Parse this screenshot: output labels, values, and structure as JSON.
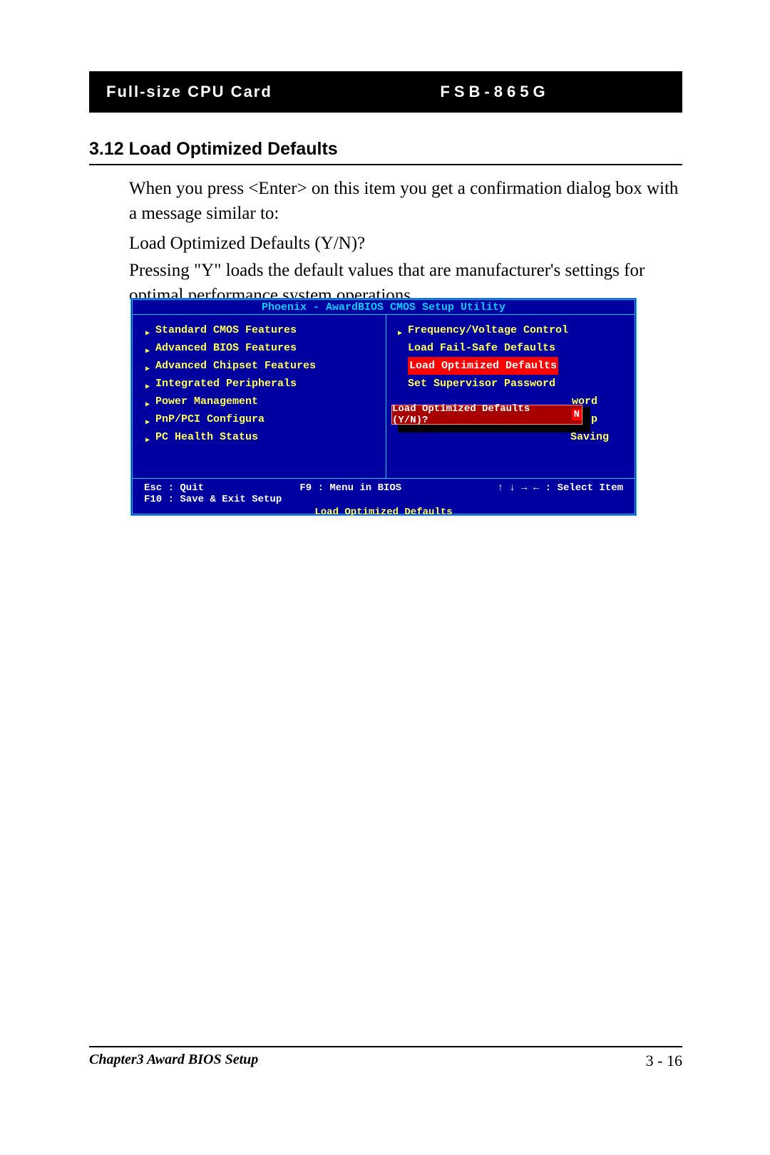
{
  "header": {
    "left": "Full-size CPU Card",
    "right": "FSB-865G"
  },
  "section": {
    "number": "3.12",
    "title": "Load Optimized Defaults"
  },
  "paragraphs": {
    "p1": "When you press <Enter> on this item you get a confirmation dialog box with a message similar to:",
    "p2": "Load Optimized Defaults (Y/N)?",
    "p3": "Pressing \"Y\" loads the default values that are manufacturer's settings for optimal performance system operations."
  },
  "bios": {
    "title": "Phoenix - AwardBIOS CMOS Setup Utility",
    "left_items": [
      {
        "label": "Standard CMOS Features",
        "arrow": true
      },
      {
        "label": "Advanced BIOS Features",
        "arrow": true
      },
      {
        "label": "Advanced Chipset Features",
        "arrow": true
      },
      {
        "label": "Integrated Peripherals",
        "arrow": true
      },
      {
        "label": "Power Management",
        "arrow": true,
        "truncated": true
      },
      {
        "label": "PnP/PCI Configura",
        "arrow": true,
        "truncated": true
      },
      {
        "label": "PC Health Status",
        "arrow": true
      }
    ],
    "right_items": [
      {
        "label": "Frequency/Voltage Control",
        "arrow": true
      },
      {
        "label": "Load Fail-Safe Defaults",
        "arrow": false
      },
      {
        "label": "Load Optimized Defaults",
        "arrow": false,
        "selected": true
      },
      {
        "label": "Set Supervisor Password",
        "arrow": false
      },
      {
        "label": "word",
        "arrow": false,
        "fragment": true
      },
      {
        "label": "etup",
        "arrow": false,
        "fragment": true
      },
      {
        "label": "Saving",
        "arrow": false,
        "fragment": true
      }
    ],
    "dialog": {
      "prompt": "Load Optimized Defaults (Y/N)?",
      "input": "N"
    },
    "help": {
      "esc": "Esc : Quit",
      "f9": "F9 : Menu in BIOS",
      "arrows": "↑ ↓ → ←   : Select Item",
      "f10": "F10 : Save & Exit Setup"
    },
    "hint": "Load Optimized Defaults"
  },
  "footer": {
    "chapter": "Chapter3 Award BIOS Setup",
    "page": "3 - 16"
  }
}
